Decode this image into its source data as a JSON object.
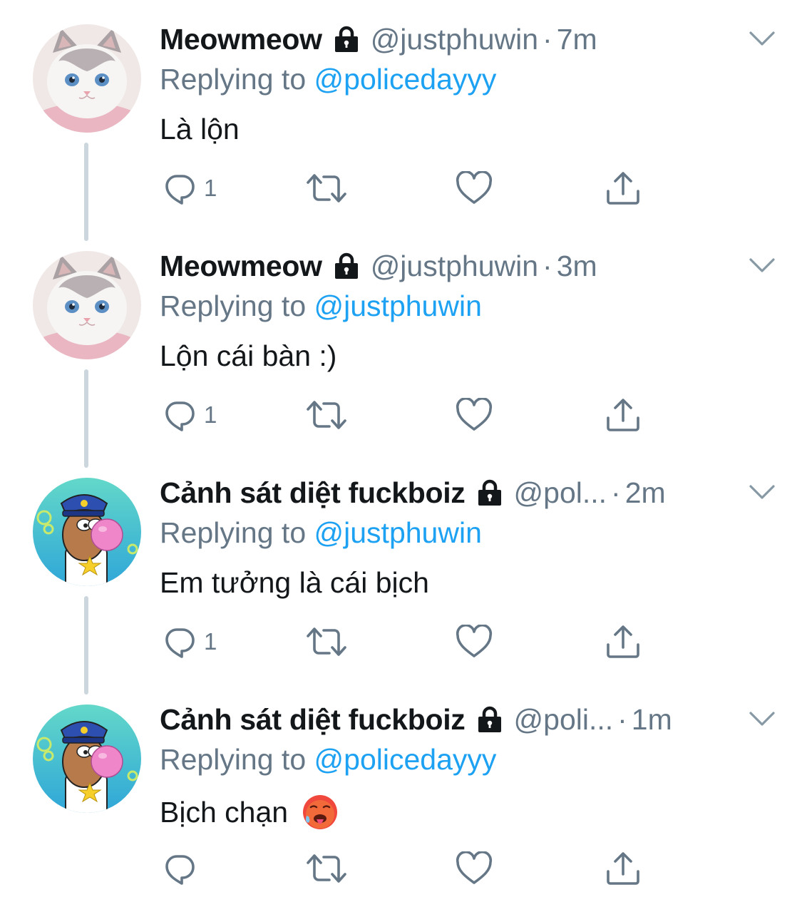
{
  "colors": {
    "name": "#14171a",
    "secondary": "#657786",
    "mention": "#1da1f2",
    "thread_line": "#ccd6dd"
  },
  "tweets": [
    {
      "avatar": "cat-avatar",
      "name": "Meowmeow",
      "handle": "@justphuwin",
      "dot": "·",
      "time": "7m",
      "replying_prefix": "Replying to ",
      "replying_to": "@policedayyy",
      "text": "Là lộn",
      "reply_count": "1"
    },
    {
      "avatar": "cat-avatar",
      "name": "Meowmeow",
      "handle": "@justphuwin",
      "dot": "·",
      "time": "3m",
      "replying_prefix": "Replying to ",
      "replying_to": "@justphuwin",
      "text": "Lộn cái bàn :)",
      "reply_count": "1"
    },
    {
      "avatar": "police-cartoon-avatar",
      "name": "Cảnh sát diệt fuckboiz",
      "handle": "@pol...",
      "dot": "·",
      "time": "2m",
      "replying_prefix": "Replying to ",
      "replying_to": "@justphuwin",
      "text": "Em tưởng là cái bịch",
      "reply_count": "1"
    },
    {
      "avatar": "police-cartoon-avatar",
      "name": "Cảnh sát diệt fuckboiz",
      "handle": "@poli...",
      "dot": "·",
      "time": "1m",
      "replying_prefix": "Replying to ",
      "replying_to": "@policedayyy",
      "text": "Bịch chạn",
      "text_emoji": "hot-face-emoji",
      "reply_count": ""
    }
  ],
  "icons": {
    "lock": "lock-icon",
    "chevron": "chevron-down-icon",
    "reply": "reply-icon",
    "retweet": "retweet-icon",
    "like": "heart-icon",
    "share": "share-icon"
  }
}
